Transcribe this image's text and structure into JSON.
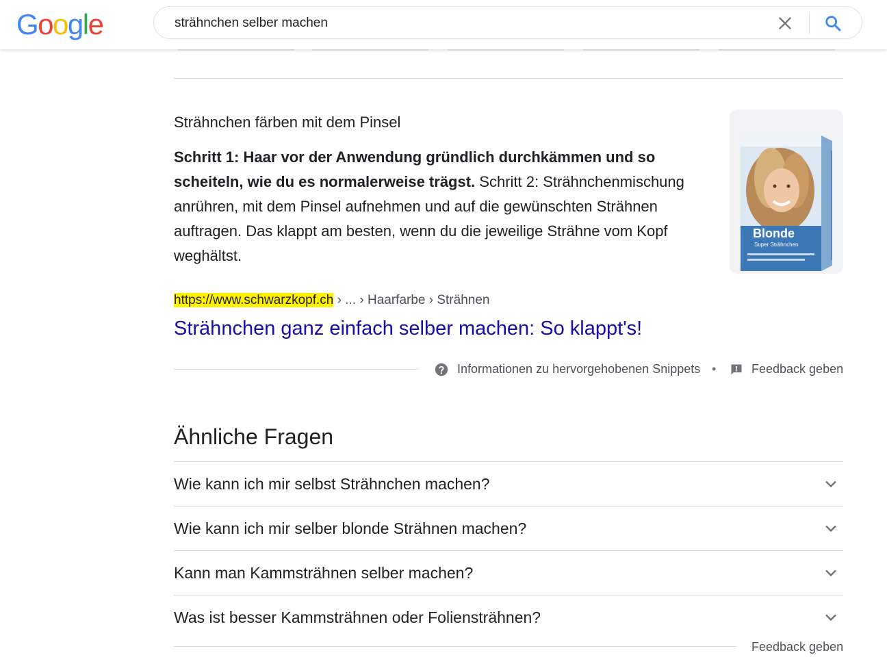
{
  "header": {
    "logo_letters": [
      "G",
      "o",
      "o",
      "g",
      "l",
      "e"
    ],
    "logo_colors": [
      "#4285F4",
      "#EA4335",
      "#FBBC05",
      "#4285F4",
      "#34A853",
      "#EA4335"
    ],
    "search_query": "strähnchen selber machen",
    "clear_icon": "close-icon",
    "search_icon": "search-icon"
  },
  "snippet": {
    "heading": "Strähnchen färben mit dem Pinsel",
    "body_bold": "Schritt 1: Haar vor der Anwendung gründlich durchkämmen und so scheiteln, wie du es normalerweise trägst.",
    "body_rest": " Schritt 2: Strähnchenmischung anrühren, mit dem Pinsel aufnehmen und auf die gewünschten Strähnen auftragen. Das klappt am besten, wenn du die jeweilige Strähne vom Kopf weghältst.",
    "image_label": "Blonde",
    "image_sublabel": "Super Strähnchen",
    "url_host": "https://www.schwarzkopf.ch",
    "url_path": " › ... › Haarfarbe › Strähnen",
    "link_title": "Strähnchen ganz einfach selber machen: So klappt's!",
    "info_text": "Informationen zu hervorgehobenen Snippets",
    "separator": "•",
    "feedback": "Feedback geben"
  },
  "related": {
    "title": "Ähnliche Fragen",
    "questions": [
      "Wie kann ich mir selbst Strähnchen machen?",
      "Wie kann ich mir selber blonde Strähnen machen?",
      "Kann man Kammsträhnen selber machen?",
      "Was ist besser Kammsträhnen oder Foliensträhnen?"
    ],
    "feedback": "Feedback geben"
  },
  "colors": {
    "link": "#1a0dab",
    "highlight": "#fff200",
    "search_blue": "#4285F4",
    "divider": "#dadce0"
  }
}
